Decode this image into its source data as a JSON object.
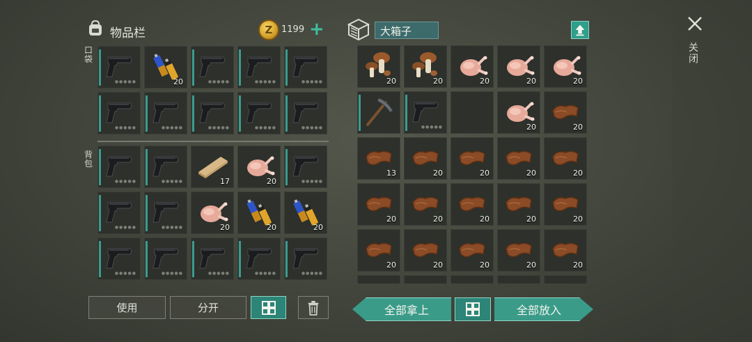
{
  "inventory": {
    "title": "物品栏",
    "coins": "1199",
    "pocket_label": "口袋",
    "backpack_label": "背包",
    "pocket": [
      {
        "item": "pistol"
      },
      {
        "item": "batteries",
        "count": "20"
      },
      {
        "item": "pistol"
      },
      {
        "item": "pistol"
      },
      {
        "item": "pistol"
      },
      {
        "item": "pistol"
      },
      {
        "item": "pistol"
      },
      {
        "item": "pistol"
      },
      {
        "item": "pistol"
      },
      {
        "item": "pistol"
      }
    ],
    "backpack": [
      {
        "item": "pistol"
      },
      {
        "item": "pistol"
      },
      {
        "item": "plank",
        "count": "17"
      },
      {
        "item": "chicken",
        "count": "20"
      },
      {
        "item": "pistol"
      },
      {
        "item": "pistol"
      },
      {
        "item": "pistol"
      },
      {
        "item": "chicken",
        "count": "20"
      },
      {
        "item": "batteries",
        "count": "20"
      },
      {
        "item": "batteries",
        "count": "20"
      },
      {
        "item": "pistol"
      },
      {
        "item": "pistol"
      },
      {
        "item": "pistol"
      },
      {
        "item": "pistol"
      },
      {
        "item": "pistol"
      }
    ]
  },
  "container": {
    "name": "大箱子",
    "slots": [
      {
        "item": "mushroom",
        "count": "20"
      },
      {
        "item": "mushroom",
        "count": "20"
      },
      {
        "item": "chicken",
        "count": "20"
      },
      {
        "item": "chicken",
        "count": "20"
      },
      {
        "item": "chicken",
        "count": "20"
      },
      {
        "item": "pickaxe"
      },
      {
        "item": "pistol"
      },
      {
        "item": "empty"
      },
      {
        "item": "chicken",
        "count": "20"
      },
      {
        "item": "leather",
        "count": "20"
      },
      {
        "item": "leather",
        "count": "13"
      },
      {
        "item": "leather",
        "count": "20"
      },
      {
        "item": "leather",
        "count": "20"
      },
      {
        "item": "leather",
        "count": "20"
      },
      {
        "item": "leather",
        "count": "20"
      },
      {
        "item": "leather",
        "count": "20"
      },
      {
        "item": "leather",
        "count": "20"
      },
      {
        "item": "leather",
        "count": "20"
      },
      {
        "item": "leather",
        "count": "20"
      },
      {
        "item": "leather",
        "count": "20"
      },
      {
        "item": "leather",
        "count": "20"
      },
      {
        "item": "leather",
        "count": "20"
      },
      {
        "item": "leather",
        "count": "20"
      },
      {
        "item": "leather",
        "count": "20"
      },
      {
        "item": "leather",
        "count": "20"
      },
      {
        "item": "empty"
      },
      {
        "item": "empty"
      },
      {
        "item": "empty"
      },
      {
        "item": "empty"
      },
      {
        "item": "empty"
      }
    ]
  },
  "buttons": {
    "use": "使用",
    "split": "分开",
    "take_all": "全部拿上",
    "put_all": "全部放入"
  },
  "close_label": "关闭",
  "icons": {
    "backpack": "backpack-icon",
    "coin": "coin-icon",
    "add_coins": "plus-icon",
    "storage_box": "storage-box-icon",
    "upload": "upload-icon",
    "close": "close-icon",
    "sort": "sort-grid-icon",
    "trash": "trash-icon"
  },
  "colors": {
    "accent": "#3a9b89",
    "durability": "#3b9c8f",
    "coin": "#d7a52d"
  }
}
